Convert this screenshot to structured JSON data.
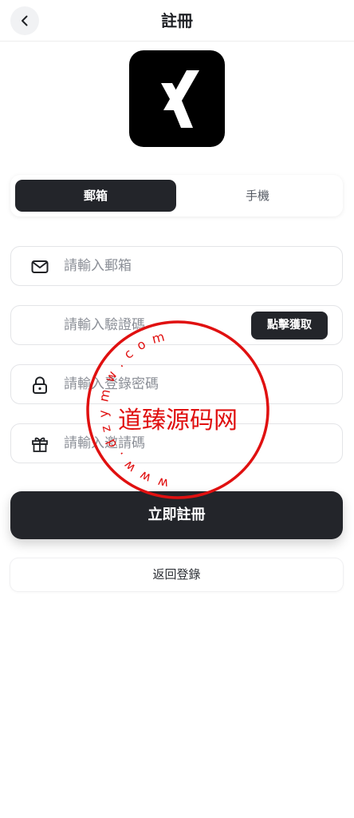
{
  "header": {
    "title": "註冊",
    "back_icon": "chevron-left-icon"
  },
  "logo": {
    "icon": "xing-logo-icon",
    "color": "#000000"
  },
  "tabs": [
    {
      "label": "郵箱",
      "active": true
    },
    {
      "label": "手機",
      "active": false
    }
  ],
  "form": {
    "email": {
      "placeholder": "請輸入郵箱",
      "value": "",
      "icon": "mail-icon"
    },
    "code": {
      "placeholder": "請輸入驗證碼",
      "value": "",
      "button_label": "點擊獲取"
    },
    "password": {
      "placeholder": "請輸入登錄密碼",
      "value": "",
      "icon": "lock-icon"
    },
    "invite": {
      "placeholder": "請輸入邀請碼",
      "value": "",
      "icon": "gift-icon"
    }
  },
  "actions": {
    "submit_label": "立即註冊",
    "back_to_login_label": "返回登錄"
  },
  "watermark": {
    "center_text": "道臻源码网",
    "ring_text": "w w w . d z y m w . c o m",
    "color": "#e01010"
  },
  "colors": {
    "primary": "#23252a",
    "background": "#ffffff"
  }
}
